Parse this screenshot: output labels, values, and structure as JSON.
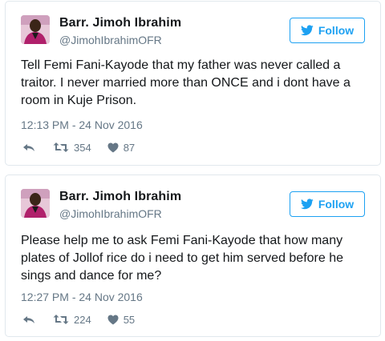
{
  "colors": {
    "brand_blue": "#1da1f2",
    "secondary_text": "#657786",
    "border": "#e1e8ed"
  },
  "tweets": [
    {
      "author": {
        "name": "Barr. Jimoh Ibrahim",
        "handle": "@JimohIbrahimOFR"
      },
      "follow_label": "Follow",
      "text": "Tell Femi Fani-Kayode that my father was never called a traitor. I never married more than ONCE and i dont have a room in Kuje Prison.",
      "timestamp": "12:13 PM - 24 Nov 2016",
      "retweets": "354",
      "likes": "87",
      "icons": [
        "reply-icon",
        "retweet-icon",
        "heart-icon",
        "twitter-bird-icon"
      ]
    },
    {
      "author": {
        "name": "Barr. Jimoh Ibrahim",
        "handle": "@JimohIbrahimOFR"
      },
      "follow_label": "Follow",
      "text": "Please help me to ask Femi Fani-Kayode that how many plates of Jollof rice do i need to get him served before he sings and dance for me?",
      "timestamp": "12:27 PM - 24 Nov 2016",
      "retweets": "224",
      "likes": "55",
      "icons": [
        "reply-icon",
        "retweet-icon",
        "heart-icon",
        "twitter-bird-icon"
      ]
    }
  ]
}
